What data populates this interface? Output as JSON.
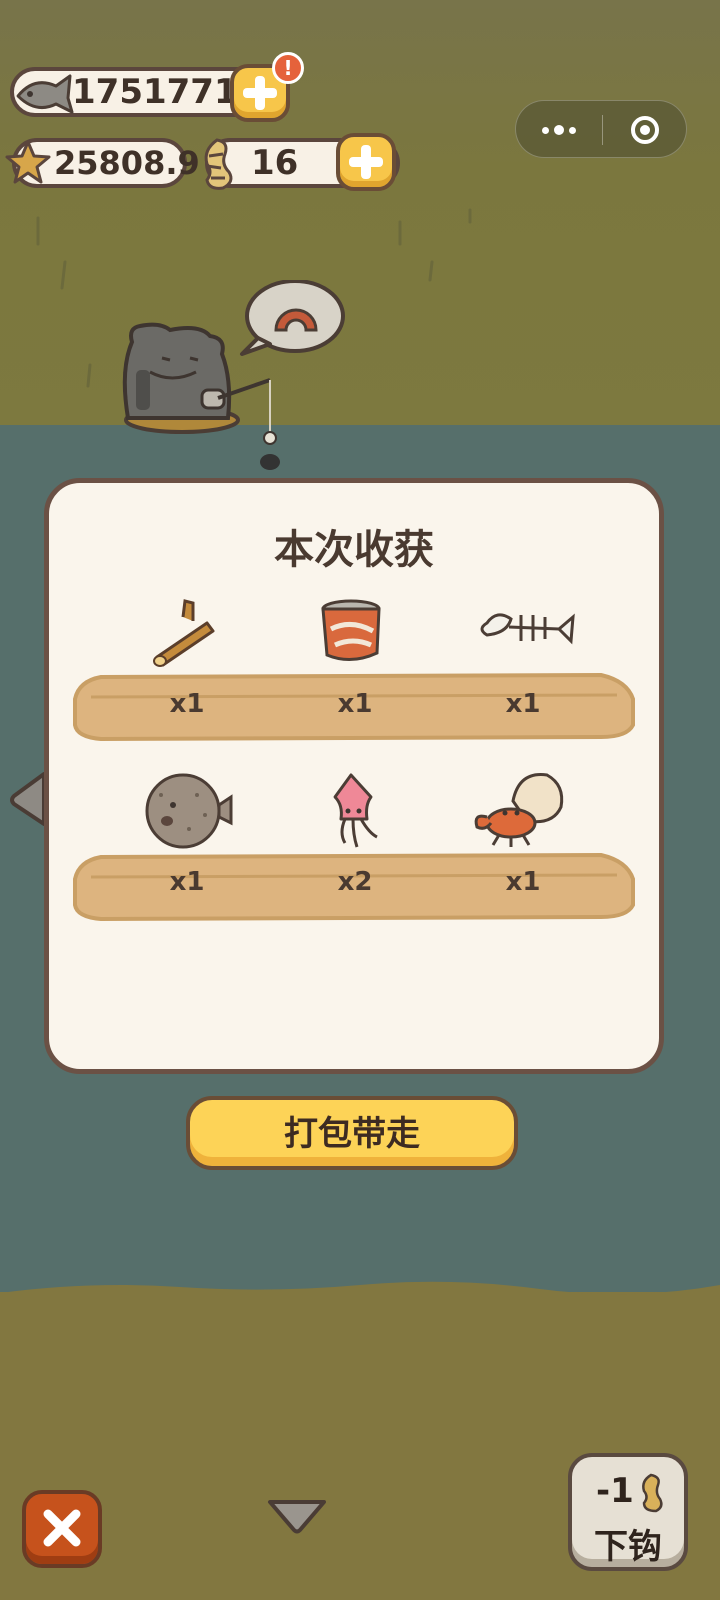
{
  "currencies": {
    "fish": "1751771",
    "stars": "25808.9",
    "worms": "16",
    "alert_symbol": "!"
  },
  "capsule": {
    "more_icon": "more-dots-icon",
    "close_icon": "target-close-icon"
  },
  "modal": {
    "title": "本次收获",
    "rows": [
      [
        {
          "item": "driftwood",
          "count": "x1"
        },
        {
          "item": "tin-can",
          "count": "x1"
        },
        {
          "item": "fish-bone",
          "count": "x1"
        }
      ],
      [
        {
          "item": "pufferfish",
          "count": "x1"
        },
        {
          "item": "squid",
          "count": "x2"
        },
        {
          "item": "hermit-crab",
          "count": "x1"
        }
      ]
    ]
  },
  "pack_button": "打包带走",
  "hook_button": {
    "cost": "-1",
    "label": "下钩"
  },
  "colors": {
    "accent_yellow": "#fdd357",
    "panel_bg": "#faf5ec",
    "border_brown": "#6b5145",
    "water": "#566f6b",
    "close_red": "#c6521c"
  }
}
